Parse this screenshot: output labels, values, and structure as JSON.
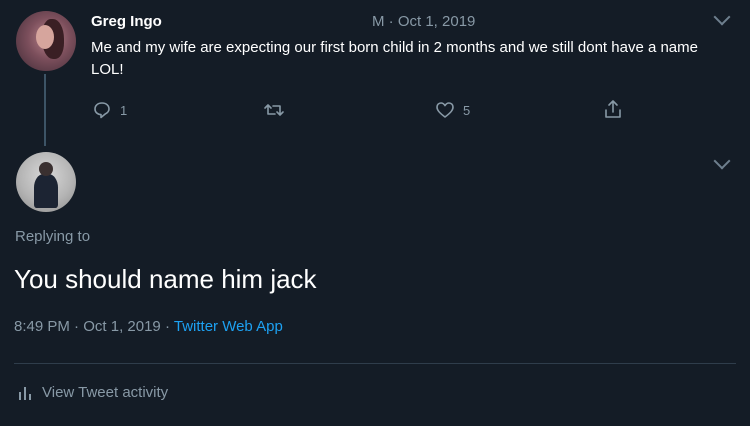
{
  "original_tweet": {
    "author": "Greg Ingo",
    "timestamp": "M · Oct 1, 2019",
    "text": "Me and my wife are expecting our first born child in 2 months and we still dont have a name LOL!",
    "reply_count": "1",
    "retweet_count": "",
    "like_count": "5",
    "icons": {
      "reply": "reply-icon",
      "retweet": "retweet-icon",
      "like": "like-icon",
      "share": "share-icon",
      "more": "chevron-down-icon"
    }
  },
  "reply_tweet": {
    "replying_to": "Replying to",
    "text": "You should name him jack",
    "time": "8:49 PM",
    "date": "Oct 1, 2019",
    "separator": "·",
    "source": "Twitter Web App",
    "activity_label": "View Tweet activity",
    "icons": {
      "more": "chevron-down-icon",
      "activity": "bar-chart-icon"
    }
  },
  "colors": {
    "background": "#141c26",
    "text_primary": "#ffffff",
    "text_secondary": "#8899a6",
    "link": "#1da1f2",
    "divider": "#2f3d4b"
  }
}
